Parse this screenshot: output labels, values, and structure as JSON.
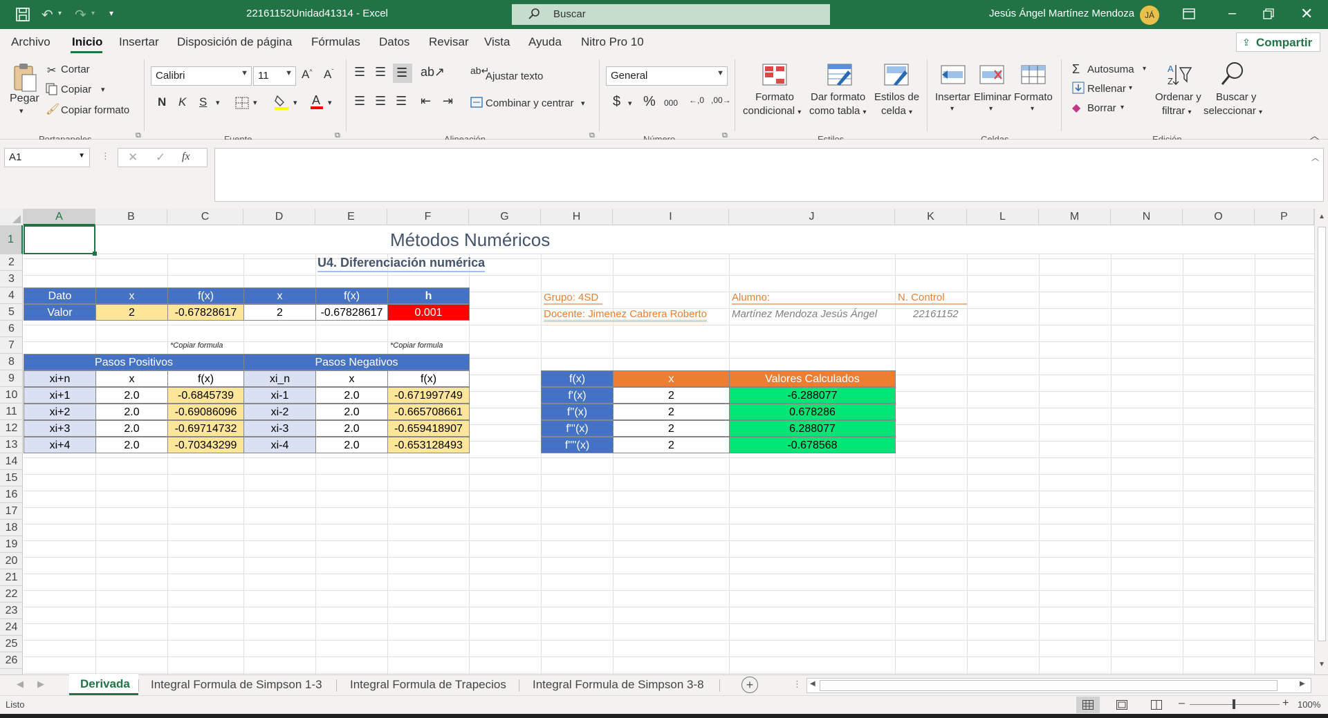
{
  "titlebar": {
    "doc_title": "22161152Unidad41314  -  Excel",
    "search_placeholder": "Buscar",
    "user_name": "Jesús Ángel Martínez Mendoza",
    "user_initials": "JÁ"
  },
  "menu": {
    "tabs": [
      "Archivo",
      "Inicio",
      "Insertar",
      "Disposición de página",
      "Fórmulas",
      "Datos",
      "Revisar",
      "Vista",
      "Ayuda",
      "Nitro Pro 10"
    ],
    "active_tab": "Inicio",
    "share": "Compartir"
  },
  "ribbon": {
    "clipboard": {
      "paste": "Pegar",
      "cut": "Cortar",
      "copy": "Copiar",
      "format_painter": "Copiar formato",
      "group": "Portapapeles"
    },
    "font": {
      "name": "Calibri",
      "size": "11",
      "bold": "N",
      "italic": "K",
      "underline": "S",
      "group": "Fuente"
    },
    "alignment": {
      "wrap": "Ajustar texto",
      "merge": "Combinar y centrar",
      "group": "Alineación"
    },
    "number": {
      "format": "General",
      "currency": "$",
      "percent": "%",
      "thousands": "000",
      "group": "Número"
    },
    "styles": {
      "cond_format": [
        "Formato",
        "condicional"
      ],
      "table_format": [
        "Dar formato",
        "como tabla"
      ],
      "cell_styles": [
        "Estilos de",
        "celda"
      ],
      "group": "Estilos"
    },
    "cells": {
      "insert": "Insertar",
      "delete": "Eliminar",
      "format": "Formato",
      "group": "Celdas"
    },
    "editing": {
      "autosum": "Autosuma",
      "fill": "Rellenar",
      "clear": "Borrar",
      "sort": [
        "Ordenar y",
        "filtrar"
      ],
      "find": [
        "Buscar y",
        "seleccionar"
      ],
      "group": "Edición"
    }
  },
  "formula_bar": {
    "name_box": "A1",
    "fx": "fx",
    "content": ""
  },
  "columns": [
    "A",
    "B",
    "C",
    "D",
    "E",
    "F",
    "G",
    "H",
    "I",
    "J",
    "K",
    "L",
    "M",
    "N",
    "O",
    "P"
  ],
  "rows": [
    "1",
    "2",
    "3",
    "4",
    "5",
    "6",
    "7",
    "8",
    "9",
    "10",
    "11",
    "12",
    "13",
    "14",
    "15",
    "16",
    "17",
    "18",
    "19",
    "20",
    "21",
    "22",
    "23",
    "24",
    "25",
    "26"
  ],
  "sheet": {
    "title": "Métodos Numéricos",
    "subtitle": "U4. Diferenciación numérica",
    "input_headers": [
      "Dato",
      "x",
      "f(x)",
      "x",
      "f(x)",
      "h"
    ],
    "input_values": [
      "Valor",
      "2",
      "-0.67828617",
      "2",
      "-0.67828617",
      "0.001"
    ],
    "copy_note": "*Copiar formula",
    "pos_title": "Pasos Positivos",
    "neg_title": "Pasos Negativos",
    "steps_headers": [
      "xi+n",
      "x",
      "f(x)",
      "xi_n",
      "x",
      "f(x)"
    ],
    "steps_rows": [
      [
        "xi+1",
        "2.0",
        "-0.6845739",
        "xi-1",
        "2.0",
        "-0.671997749"
      ],
      [
        "xi+2",
        "2.0",
        "-0.69086096",
        "xi-2",
        "2.0",
        "-0.665708661"
      ],
      [
        "xi+3",
        "2.0",
        "-0.69714732",
        "xi-3",
        "2.0",
        "-0.659418907"
      ],
      [
        "xi+4",
        "2.0",
        "-0.70343299",
        "xi-4",
        "2.0",
        "-0.653128493"
      ]
    ],
    "info": {
      "group_label": "Grupo: 4SD",
      "teacher_label": "Docente: Jimenez Cabrera Roberto",
      "student_label": "Alumno:",
      "control_label": "N. Control",
      "student_name": "Martínez Mendoza Jesús Ángel",
      "control_number": "22161152"
    },
    "results_headers": [
      "f(x)",
      "x",
      "Valores Calculados"
    ],
    "results_rows": [
      [
        "f'(x)",
        "2",
        "-6.288077"
      ],
      [
        "f''(x)",
        "2",
        "0.678286"
      ],
      [
        "f'''(x)",
        "2",
        "6.288077"
      ],
      [
        "f''''(x)",
        "2",
        "-0.678568"
      ]
    ]
  },
  "sheet_tabs": [
    "Derivada",
    "Integral Formula de Simpson 1-3",
    "Integral Formula de Trapecios",
    "Integral Formula de Simpson 3-8"
  ],
  "active_sheet": "Derivada",
  "status": {
    "ready": "Listo",
    "zoom": "100%"
  },
  "colors": {
    "excel_green": "#217346",
    "header_blue": "#4472c4",
    "light_blue": "#d9e1f2",
    "input_yellow": "#ffe699",
    "h_red": "#ff0000",
    "result_orange": "#ed7d31",
    "result_green": "#00e676",
    "info_orange": "#ed7d31"
  }
}
